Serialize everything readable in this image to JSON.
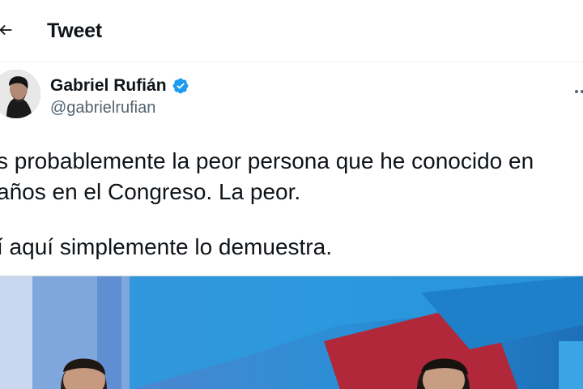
{
  "header": {
    "back_icon": "arrow-left-icon",
    "title": "Tweet"
  },
  "author": {
    "name": "Gabriel Rufián",
    "handle": "@gabrielrufian",
    "verified_icon": "verified-badge-icon",
    "verified_color": "#1d9bf0",
    "more_icon": "more-options-icon"
  },
  "tweet": {
    "lines": [
      "s probablemente la peor persona que he conocido en",
      " años en el Congreso. La peor.",
      "í aquí simplemente lo demuestra."
    ]
  },
  "colors": {
    "text": "#0f1419",
    "secondary": "#536471",
    "accent": "#1d9bf0"
  }
}
